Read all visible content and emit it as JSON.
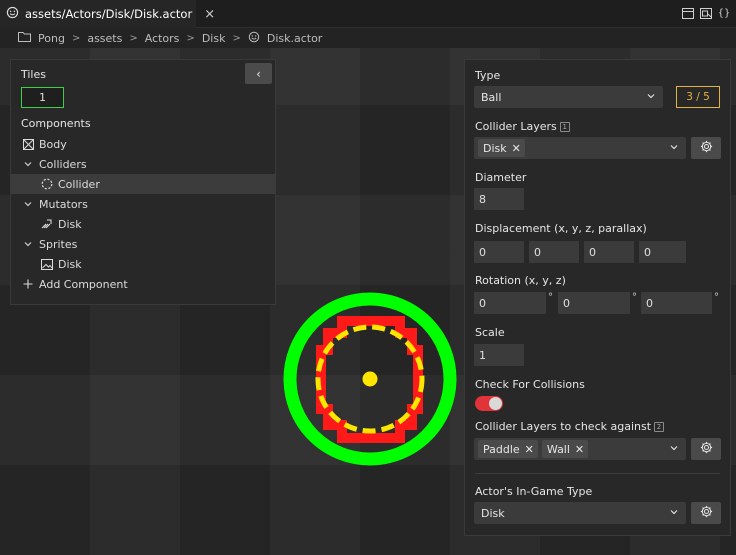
{
  "tab": {
    "title": "assets/Actors/Disk/Disk.actor",
    "close": "×"
  },
  "window_icons": [
    "panel-layout-icon",
    "preview-icon",
    "code-braces-icon"
  ],
  "breadcrumb": {
    "items": [
      "Pong",
      "assets",
      "Actors",
      "Disk",
      "Disk.actor"
    ],
    "separator": ">"
  },
  "left_panel": {
    "collapse": "‹",
    "tiles_label": "Tiles",
    "tiles_value": "1",
    "components_label": "Components",
    "tree": [
      {
        "label": "Body",
        "icon": "body-grid-icon",
        "indent": 0,
        "expandable": false
      },
      {
        "label": "Colliders",
        "icon": "chevron-down-icon",
        "indent": 0,
        "expandable": true
      },
      {
        "label": "Collider",
        "icon": "dashed-circle-icon",
        "indent": 1,
        "selected": true
      },
      {
        "label": "Mutators",
        "icon": "chevron-down-icon",
        "indent": 0,
        "expandable": true
      },
      {
        "label": "Disk",
        "icon": "mutator-icon",
        "indent": 1
      },
      {
        "label": "Sprites",
        "icon": "chevron-down-icon",
        "indent": 0,
        "expandable": true
      },
      {
        "label": "Disk",
        "icon": "image-icon",
        "indent": 1
      },
      {
        "label": "Add Component",
        "icon": "plus-icon",
        "indent": 0,
        "action": true
      }
    ]
  },
  "right_panel": {
    "type_label": "Type",
    "type_value": "Ball",
    "type_counter": "3 / 5",
    "collider_layers_label": "Collider Layers",
    "collider_layers_tip": "1",
    "collider_layers": [
      "Disk"
    ],
    "diameter_label": "Diameter",
    "diameter_value": "8",
    "displacement_label": "Displacement (x, y, z, parallax)",
    "displacement": [
      "0",
      "0",
      "0",
      "0"
    ],
    "rotation_label": "Rotation (x, y, z)",
    "rotation": [
      "0",
      "0",
      "0"
    ],
    "degree_symbol": "°",
    "scale_label": "Scale",
    "scale_value": "1",
    "check_collisions_label": "Check For Collisions",
    "check_collisions": true,
    "check_layers_label": "Collider Layers to check against",
    "check_layers_tip": "2",
    "check_layers": [
      "Paddle",
      "Wall"
    ],
    "ingame_type_label": "Actor's In-Game Type",
    "ingame_type_value": "Disk"
  },
  "colors": {
    "accent_green": "#3ecf45",
    "counter_yellow": "#e3b341",
    "toggle_on": "#e0343a",
    "disk_green": "#00ff00",
    "disk_red": "#ff1a1a",
    "disk_yellow": "#ffe600"
  }
}
